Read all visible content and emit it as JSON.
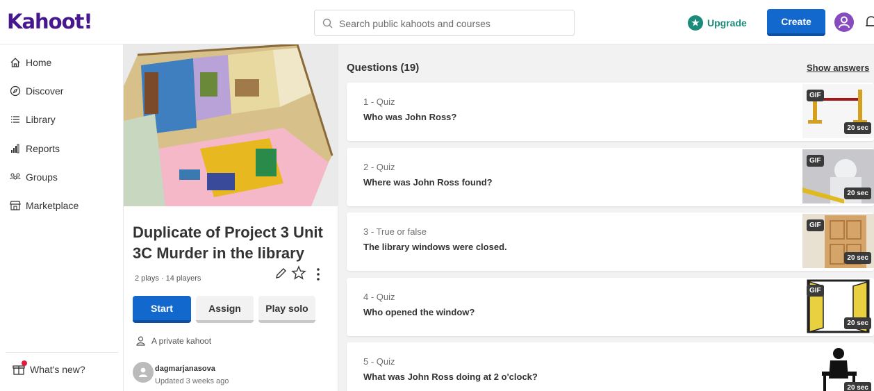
{
  "header": {
    "logo": "Kahoot!",
    "search_placeholder": "Search public kahoots and courses",
    "upgrade_label": "Upgrade",
    "create_label": "Create"
  },
  "sidebar": {
    "items": [
      {
        "label": "Home",
        "icon": "home-icon"
      },
      {
        "label": "Discover",
        "icon": "compass-icon"
      },
      {
        "label": "Library",
        "icon": "list-icon"
      },
      {
        "label": "Reports",
        "icon": "bar-chart-icon"
      },
      {
        "label": "Groups",
        "icon": "people-icon"
      },
      {
        "label": "Marketplace",
        "icon": "store-icon"
      }
    ],
    "whats_new": "What's new?"
  },
  "kahoot": {
    "title": "Duplicate of Project 3 Unit 3C Murder in the library",
    "meta": "2 plays · 14 players",
    "start_label": "Start",
    "assign_label": "Assign",
    "solo_label": "Play solo",
    "visibility": "A private kahoot",
    "owner": "dagmarjanasova",
    "updated": "Updated 3 weeks ago"
  },
  "questions_panel": {
    "header": "Questions (19)",
    "show_answers": "Show answers",
    "questions": [
      {
        "type": "1 - Quiz",
        "text": "Who was John Ross?",
        "gif": "GIF",
        "time": "20 sec"
      },
      {
        "type": "2 - Quiz",
        "text": "Where was John Ross found?",
        "gif": "GIF",
        "time": "20 sec"
      },
      {
        "type": "3 - True or false",
        "text": "The library windows were closed.",
        "gif": "GIF",
        "time": "20 sec"
      },
      {
        "type": "4 - Quiz",
        "text": "Who opened the window?",
        "gif": "GIF",
        "time": "20 sec"
      },
      {
        "type": "5 - Quiz",
        "text": "What was John Ross doing at 2 o'clock?",
        "gif": "",
        "time": "20 sec"
      }
    ]
  },
  "colors": {
    "brand": "#46178f",
    "primary_button": "#1368ce",
    "upgrade": "#1a8a7a",
    "avatar": "#864cbf"
  }
}
